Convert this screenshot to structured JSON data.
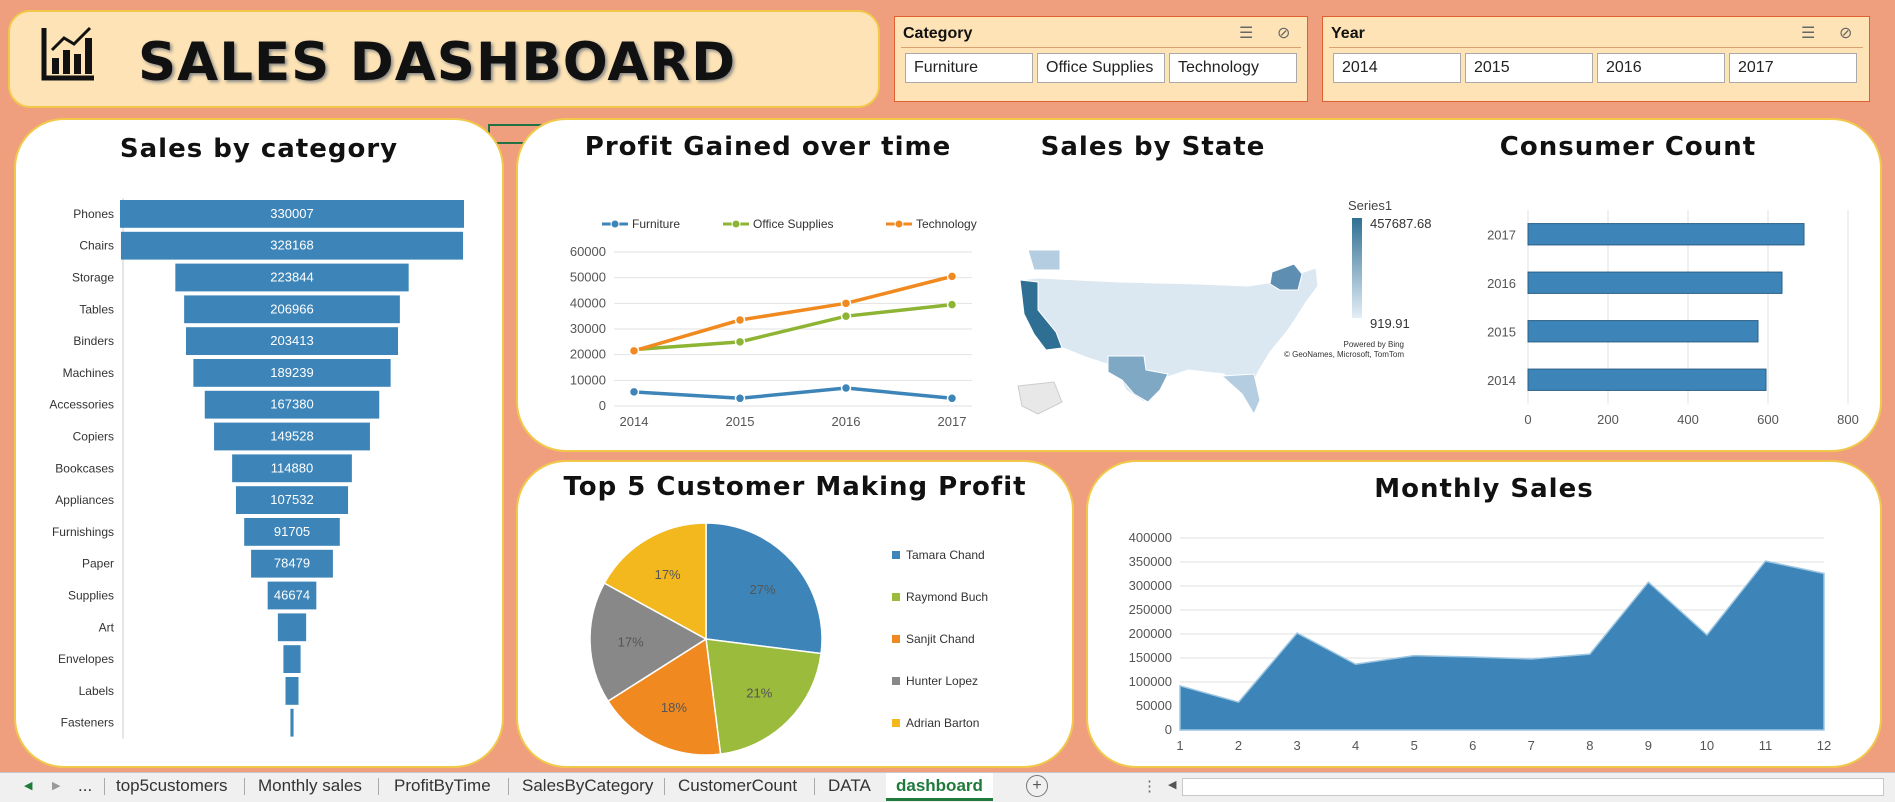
{
  "header": {
    "title": "SALES DASHBOARD",
    "icon": "chart-icon"
  },
  "slicers": {
    "category": {
      "title": "Category",
      "items": [
        "Furniture",
        "Office Supplies",
        "Technology"
      ]
    },
    "year": {
      "title": "Year",
      "items": [
        "2014",
        "2015",
        "2016",
        "2017"
      ]
    }
  },
  "panels": {
    "category_title": "Sales by category",
    "profit_title": "Profit Gained over time",
    "state_title": "Sales by State",
    "consumer_title": "Consumer Count",
    "top5_title": "Top 5 Customer Making Profit",
    "monthly_title": "Monthly Sales"
  },
  "map": {
    "legend_title": "Series1",
    "max_label": "457687.68",
    "min_label": "919.91",
    "credit1": "Powered by Bing",
    "credit2": "© GeoNames, Microsoft, TomTom"
  },
  "chart_data": [
    {
      "type": "bar",
      "title": "Sales by category",
      "categories": [
        "Phones",
        "Chairs",
        "Storage",
        "Tables",
        "Binders",
        "Machines",
        "Accessories",
        "Copiers",
        "Bookcases",
        "Appliances",
        "Furnishings",
        "Paper",
        "Supplies",
        "Art",
        "Envelopes",
        "Labels",
        "Fasteners"
      ],
      "values": [
        330007,
        328168,
        223844,
        206966,
        203413,
        189239,
        167380,
        149528,
        114880,
        107532,
        91705,
        78479,
        46674,
        27119,
        16476,
        12486,
        3024
      ],
      "data_labels": [
        "330007",
        "328168",
        "223844",
        "206966",
        "203413",
        "189239",
        "167380",
        "149528",
        "114880",
        "107532",
        "91705",
        "78479",
        "46674",
        "",
        "",
        "",
        ""
      ],
      "color": "#3d85b8"
    },
    {
      "type": "line",
      "title": "Profit Gained over time",
      "categories": [
        "2014",
        "2015",
        "2016",
        "2017"
      ],
      "series": [
        {
          "name": "Furniture",
          "values": [
            5500,
            3000,
            7000,
            3000
          ],
          "color": "#3d85b8"
        },
        {
          "name": "Office Supplies",
          "values": [
            22000,
            25000,
            35000,
            39500
          ],
          "color": "#8db432"
        },
        {
          "name": "Technology",
          "values": [
            21500,
            33500,
            40000,
            50500
          ],
          "color": "#f08a20"
        }
      ],
      "ylim": [
        0,
        60000
      ],
      "yticks": [
        "0",
        "10000",
        "20000",
        "30000",
        "40000",
        "50000",
        "60000"
      ]
    },
    {
      "type": "bar",
      "title": "Consumer Count",
      "categories": [
        "2017",
        "2016",
        "2015",
        "2014"
      ],
      "values": [
        690,
        635,
        575,
        595
      ],
      "xlim": [
        0,
        800
      ],
      "xticks": [
        "0",
        "200",
        "400",
        "600",
        "800"
      ],
      "color": "#3d85b8"
    },
    {
      "type": "pie",
      "title": "Top 5 Customer Making Profit",
      "labels": [
        "Tamara Chand",
        "Raymond Buch",
        "Sanjit Chand",
        "Hunter Lopez",
        "Adrian Barton"
      ],
      "values": [
        27,
        21,
        18,
        17,
        17
      ],
      "value_labels": [
        "27%",
        "21%",
        "18%",
        "17%",
        "17%"
      ],
      "colors": [
        "#3d85b8",
        "#9bbb3c",
        "#f08a20",
        "#888888",
        "#f2b81e"
      ]
    },
    {
      "type": "area",
      "title": "Monthly Sales",
      "x": [
        1,
        2,
        3,
        4,
        5,
        6,
        7,
        8,
        9,
        10,
        11,
        12
      ],
      "values": [
        92000,
        58000,
        202000,
        137000,
        155000,
        152000,
        148000,
        158000,
        308000,
        198000,
        352000,
        326000
      ],
      "ylim": [
        0,
        400000
      ],
      "yticks": [
        "0",
        "50000",
        "100000",
        "150000",
        "200000",
        "250000",
        "300000",
        "350000",
        "400000"
      ],
      "color": "#3d85b8"
    }
  ],
  "tabs": {
    "items": [
      "top5customers",
      "Monthly sales",
      "ProfitByTime",
      "SalesByCategory",
      "CustomerCount",
      "DATA",
      "dashboard"
    ],
    "active": "dashboard",
    "ellipsis": "...",
    "prev_icon": "◀",
    "next_icon": "▶",
    "add_icon": "+",
    "more_icon": "⋮"
  }
}
